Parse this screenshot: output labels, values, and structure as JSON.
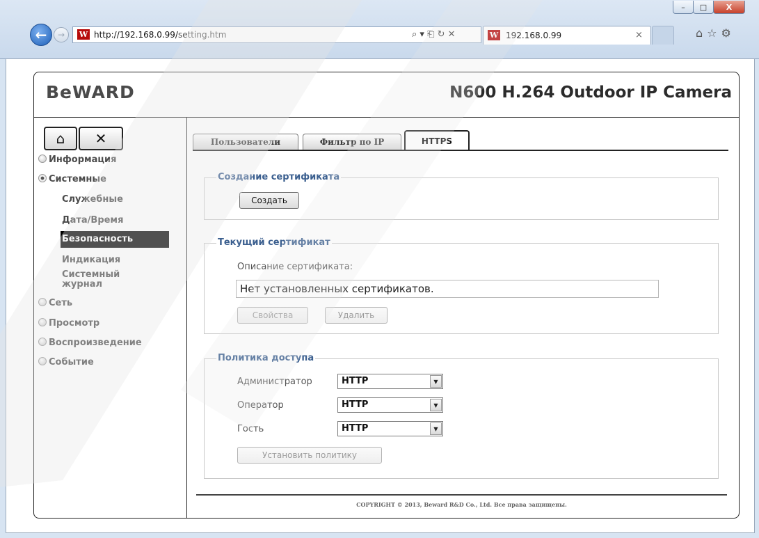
{
  "browser": {
    "url_host": "http://192.168.0.99/",
    "url_path": "setting.htm",
    "address_tools": "⌕ ▾ ⎗ ↻ ✕",
    "tab_title": "192.168.0.99",
    "tab_close": "×",
    "favicon": "W",
    "win_buttons": {
      "minimize": "–",
      "maximize": "□",
      "close": "X"
    },
    "right_icons": "⌂☆⚙"
  },
  "header": {
    "logo": "BeWARD",
    "camera_title": "N600 H.264 Outdoor IP Camera"
  },
  "toolbar": {
    "home_icon": "⌂",
    "tools_icon": "✕"
  },
  "sidebar": {
    "sections": [
      {
        "label": "Информация",
        "expanded": false
      },
      {
        "label": "Системные",
        "expanded": true
      },
      {
        "label": "Сеть",
        "expanded": false
      },
      {
        "label": "Просмотр",
        "expanded": false
      },
      {
        "label": "Воспроизведение",
        "expanded": false
      },
      {
        "label": "Событие",
        "expanded": false
      }
    ],
    "system_items": [
      "Служебные",
      "Дата/Время",
      "Безопасность",
      "Индикация",
      "Системный журнал"
    ],
    "active_item": "Безопасность"
  },
  "tabs": [
    {
      "label": "Пользователи",
      "active": false
    },
    {
      "label": "Фильтр по IP",
      "active": false
    },
    {
      "label": "HTTPS",
      "active": true
    }
  ],
  "create_cert": {
    "legend": "Создание сертификата",
    "button": "Создать"
  },
  "current_cert": {
    "legend": "Текущий сертификат",
    "desc_label": "Описание сертификата:",
    "desc_value": "Нет установленных сертификатов.",
    "properties_button": "Свойства",
    "delete_button": "Удалить"
  },
  "access_policy": {
    "legend": "Политика доступа",
    "rows": [
      {
        "label": "Администратор",
        "value": "HTTP"
      },
      {
        "label": "Оператор",
        "value": "HTTP"
      },
      {
        "label": "Гость",
        "value": "HTTP"
      }
    ],
    "apply_button": "Установить политику"
  },
  "footer": {
    "copyright": "COPYRIGHT © 2013, Beward R&D Co., Ltd. Все права защищены."
  }
}
